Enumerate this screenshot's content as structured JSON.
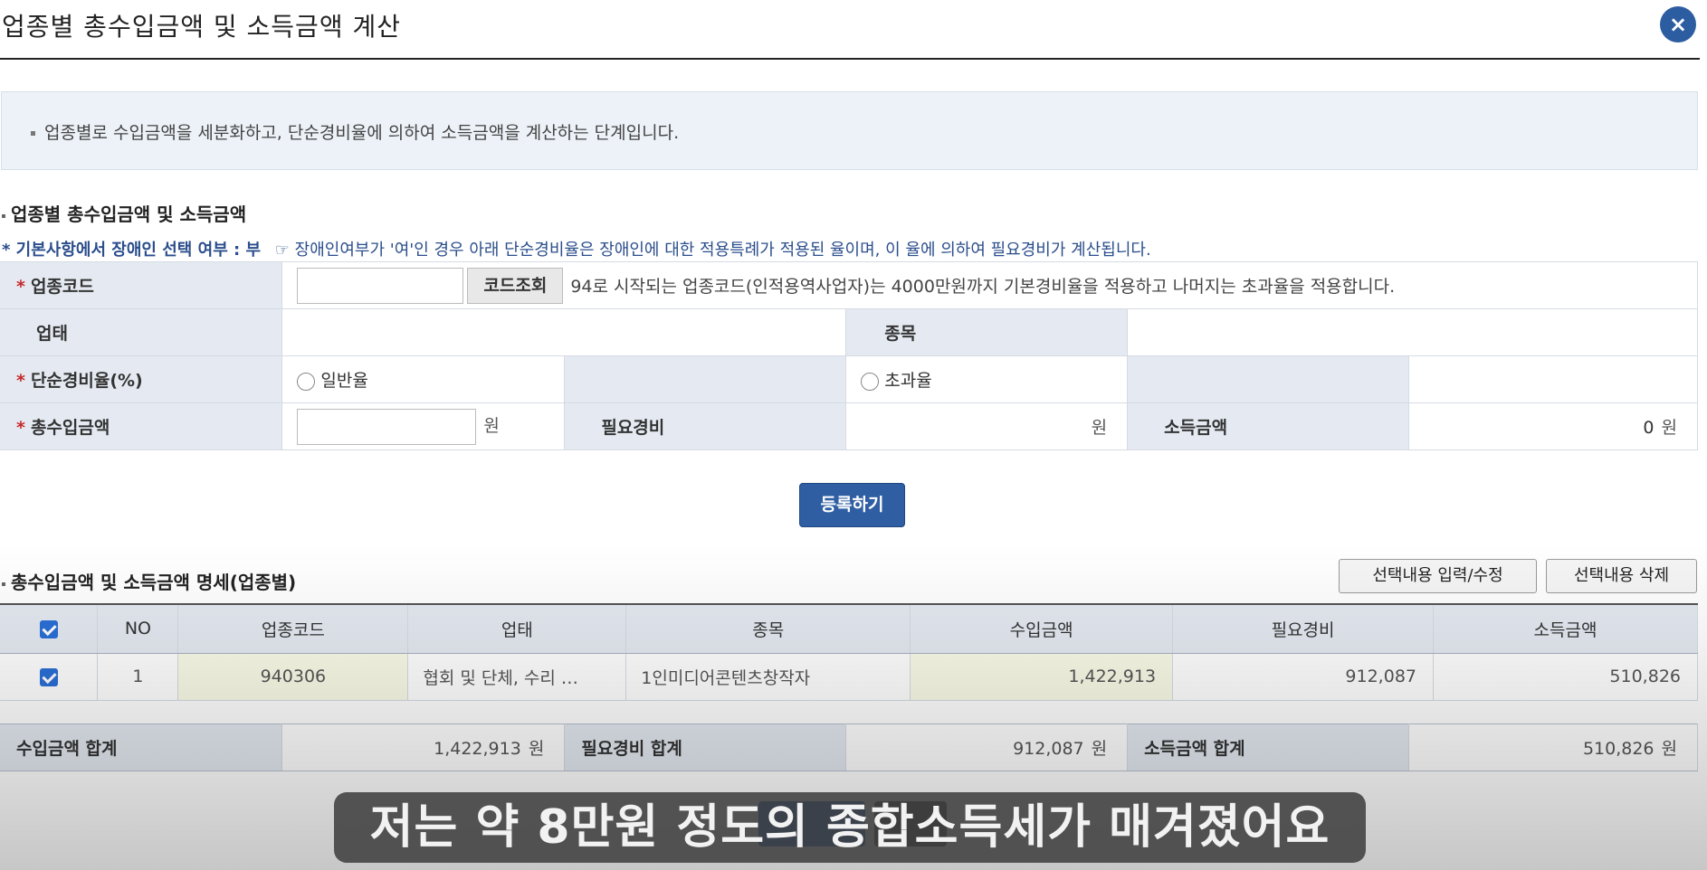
{
  "dialog": {
    "title": "업종별 총수입금액 및 소득금액 계산",
    "close_label": "×"
  },
  "info": {
    "text": "업종별로 수입금액을 세분화하고, 단순경비율에 의하여 소득금액을 계산하는 단계입니다."
  },
  "section1": {
    "title": "업종별 총수입금액 및 소득금액",
    "notice_prefix": "* 기본사항에서 장애인 선택 여부 : 부",
    "notice_icon": "☞",
    "notice_text": "장애인여부가 '여'인 경우 아래 단순경비율은 장애인에 대한 적용특례가 적용된 율이며, 이 율에 의하여 필요경비가 계산됩니다."
  },
  "form": {
    "business_code_label": "업종코드",
    "business_code_value": "",
    "code_lookup_button": "코드조회",
    "code_note": "94로 시작되는 업종코드(인적용역사업자)는 4000만원까지 기본경비율을 적용하고 나머지는 초과율을 적용합니다.",
    "type_label": "업태",
    "type_value": "",
    "item_label": "종목",
    "item_value": "",
    "rate_label": "단순경비율(%)",
    "rate_general": "일반율",
    "rate_excess": "초과율",
    "revenue_label": "총수입금액",
    "revenue_value": "",
    "won": "원",
    "expense_label": "필요경비",
    "expense_value": "",
    "income_label": "소득금액",
    "income_value": "0"
  },
  "register_button": "등록하기",
  "section2": {
    "title": "총수입금액 및 소득금액 명세(업종별)",
    "edit_button": "선택내용 입력/수정",
    "delete_button": "선택내용 삭제"
  },
  "table": {
    "headers": [
      "NO",
      "업종코드",
      "업태",
      "종목",
      "수입금액",
      "필요경비",
      "소득금액"
    ],
    "rows": [
      {
        "no": "1",
        "code": "940306",
        "type": "협회 및 단체, 수리 …",
        "item": "1인미디어콘텐츠창작자",
        "revenue": "1,422,913",
        "expense": "912,087",
        "income": "510,826"
      }
    ]
  },
  "totals": {
    "revenue_label": "수입금액 합계",
    "revenue_value": "1,422,913",
    "expense_label": "필요경비 합계",
    "expense_value": "912,087",
    "income_label": "소득금액 합계",
    "income_value": "510,826",
    "won": "원"
  },
  "caption": "저는 약 8만원 정도의 종합소득세가 매겨졌어요",
  "colors": {
    "primary": "#2f5ea3",
    "label_bg": "#e5eaf2",
    "required": "#c52a2a",
    "notice": "#2b4e8c"
  }
}
